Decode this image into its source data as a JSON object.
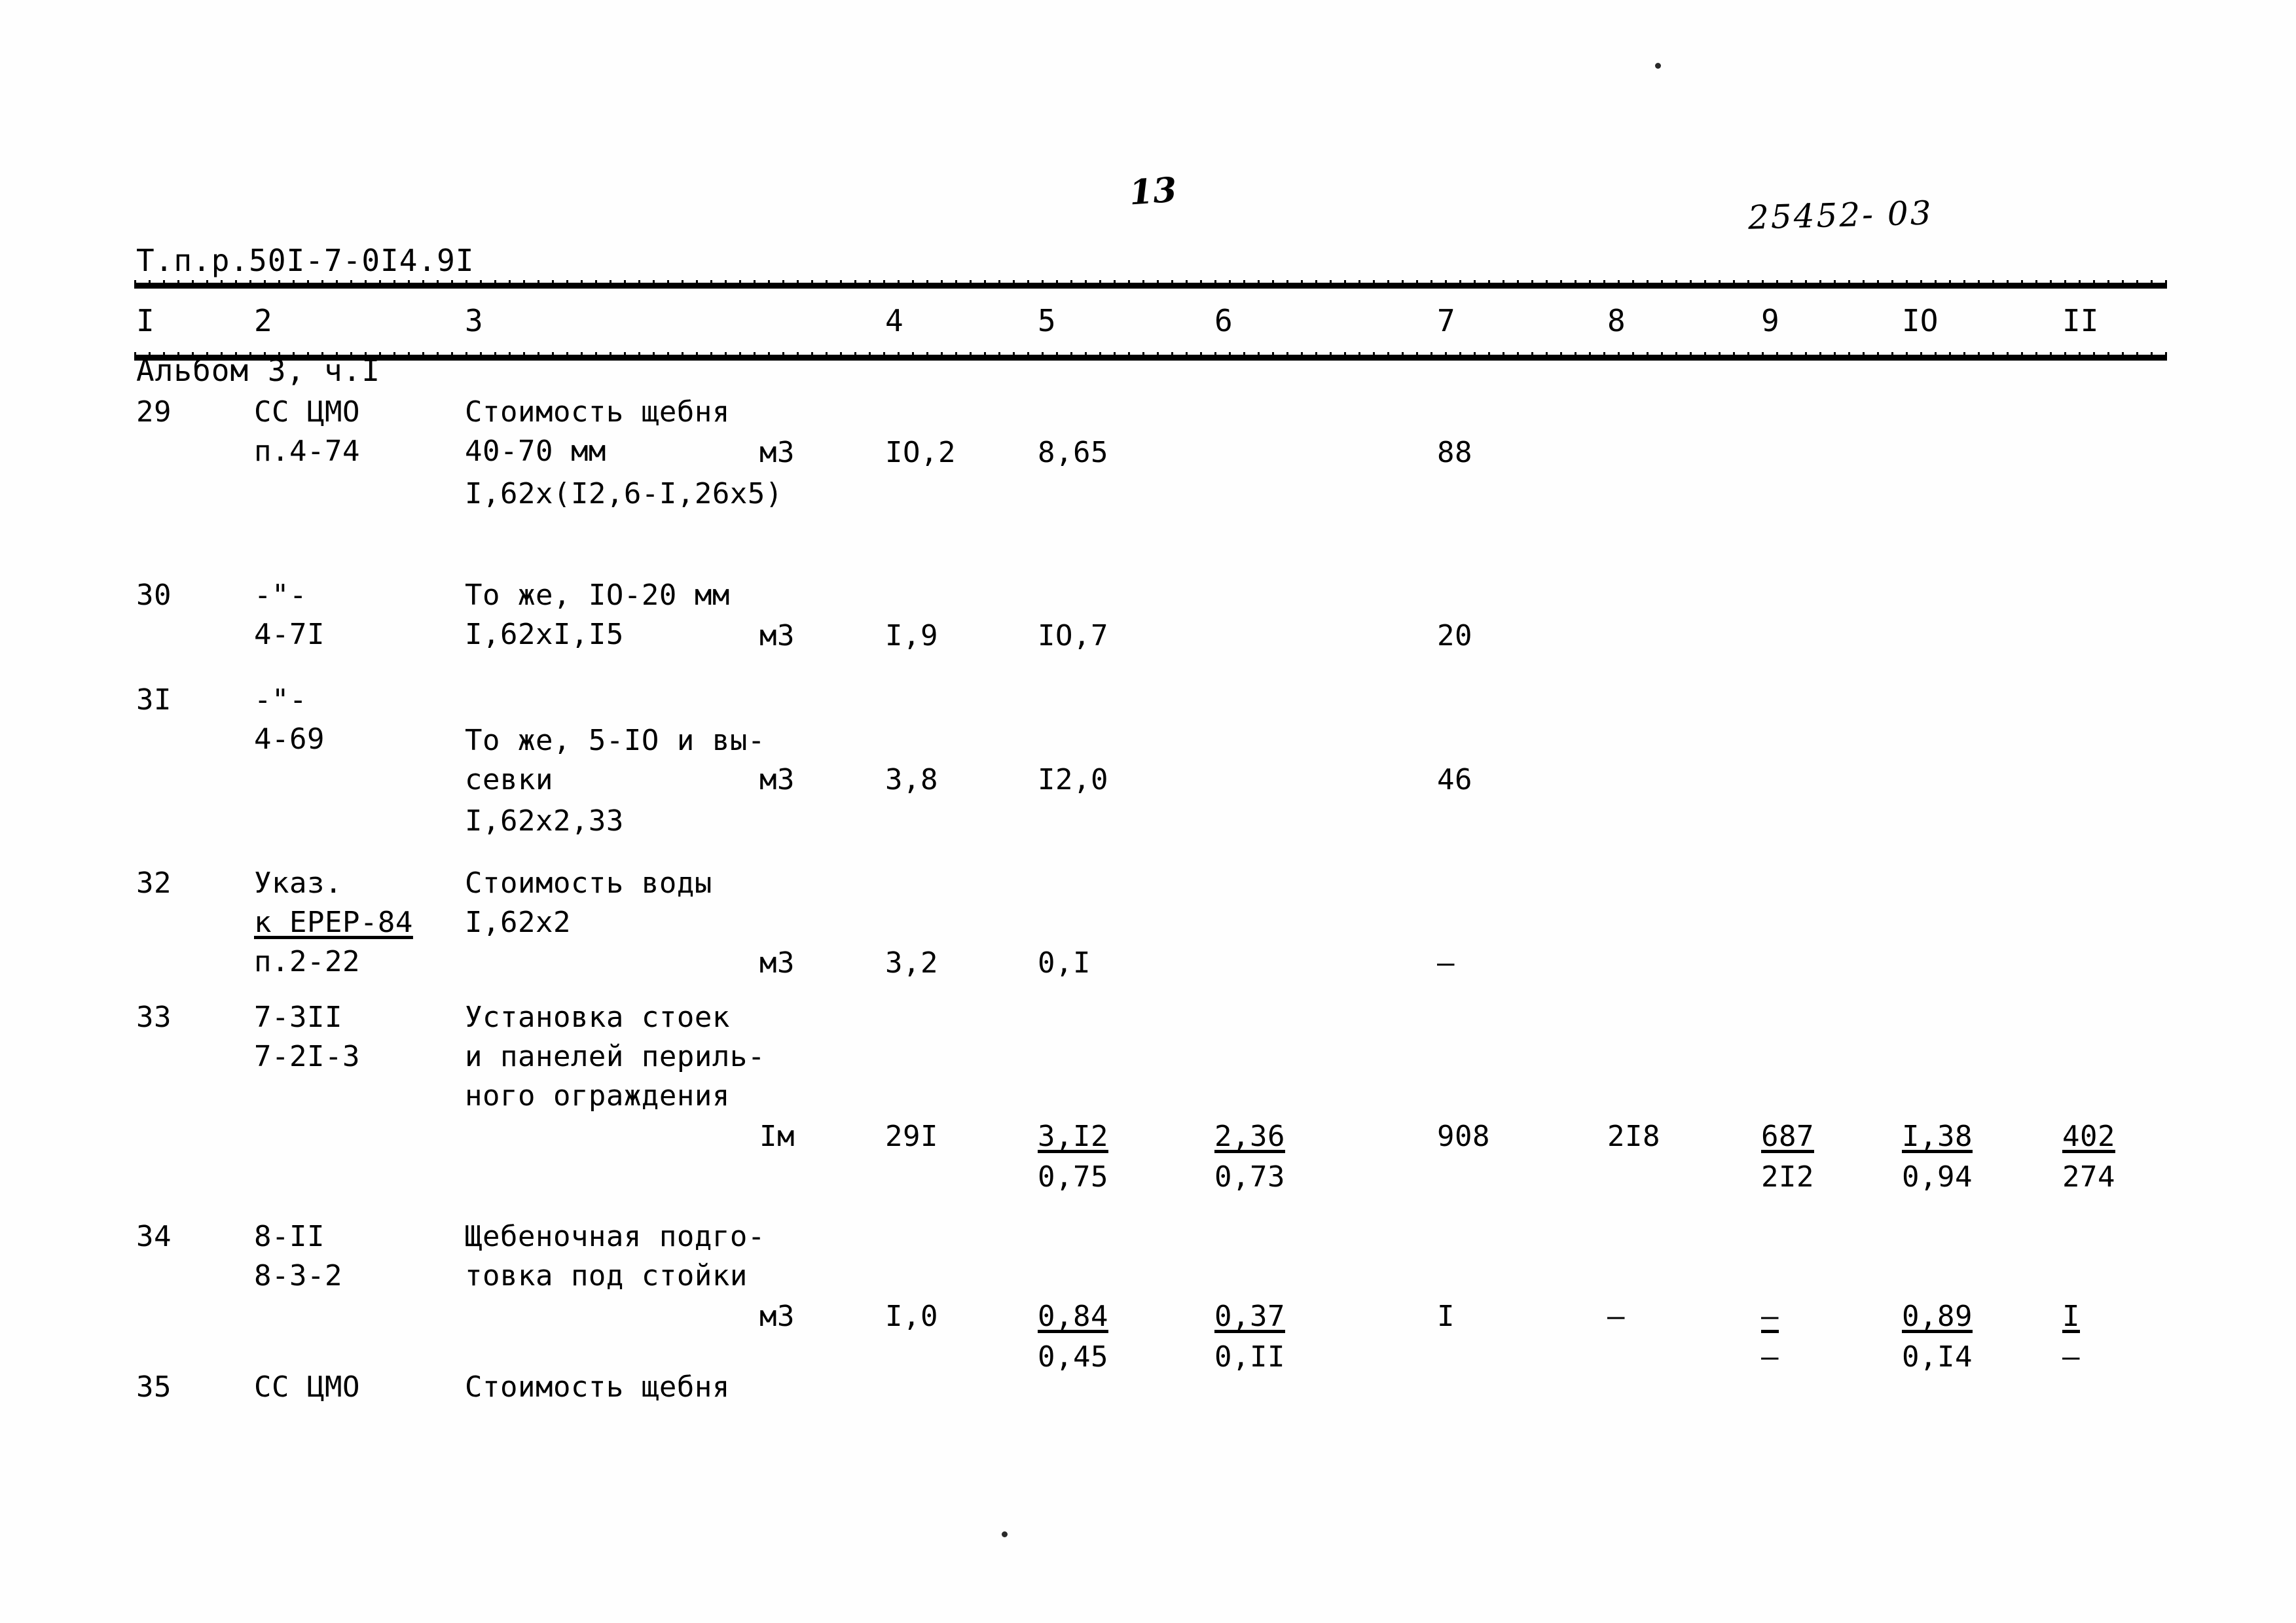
{
  "document": {
    "series_code": "Т.п.р.50I-7-0I4.9I",
    "album": "Альбом 3, ч.I",
    "page_number": "13",
    "archive_stamp": "25452- 03"
  },
  "table": {
    "column_headers": [
      "I",
      "2",
      "3",
      "4",
      "5",
      "6",
      "7",
      "8",
      "9",
      "IO",
      "II"
    ],
    "rows": [
      {
        "num": "29",
        "code_lines": [
          "СС ЦМО",
          "п.4-74"
        ],
        "desc_lines": [
          "Стоимость щебня",
          "40-70 мм"
        ],
        "formula": "I,62х(I2,6-I,26х5)",
        "unit": "м3",
        "c4": "IO,2",
        "c5": "8,65",
        "c6": "",
        "c7": "88",
        "c8": "",
        "c9": "",
        "c10": "",
        "c11": "",
        "c5b": "",
        "c6b": "",
        "c9b": "",
        "c10b": "",
        "c11b": ""
      },
      {
        "num": "30",
        "code_lines": [
          "-\"-",
          "4-7I"
        ],
        "desc_lines": [
          "То же, IO-20 мм",
          "I,62хI,I5"
        ],
        "formula": "",
        "unit": "м3",
        "c4": "I,9",
        "c5": "IO,7",
        "c6": "",
        "c7": "20",
        "c8": "",
        "c9": "",
        "c10": "",
        "c11": "",
        "c5b": "",
        "c6b": "",
        "c9b": "",
        "c10b": "",
        "c11b": ""
      },
      {
        "num": "3I",
        "code_lines": [
          "-\"-",
          "4-69"
        ],
        "desc_lines": [
          "То же, 5-IO и вы-",
          "севки"
        ],
        "formula": "I,62х2,33",
        "unit": "м3",
        "c4": "3,8",
        "c5": "I2,0",
        "c6": "",
        "c7": "46",
        "c8": "",
        "c9": "",
        "c10": "",
        "c11": "",
        "c5b": "",
        "c6b": "",
        "c9b": "",
        "c10b": "",
        "c11b": ""
      },
      {
        "num": "32",
        "code_lines": [
          "Указ.",
          "к ЕРЕР-84",
          "п.2-22"
        ],
        "desc_lines": [
          "Стоимость воды",
          "I,62х2"
        ],
        "formula": "",
        "unit": "м3",
        "c4": "3,2",
        "c5": "0,I",
        "c6": "",
        "c7": "–",
        "c8": "",
        "c9": "",
        "c10": "",
        "c11": "",
        "c5b": "",
        "c6b": "",
        "c9b": "",
        "c10b": "",
        "c11b": ""
      },
      {
        "num": "33",
        "code_lines": [
          "7-3II",
          "7-2I-3"
        ],
        "desc_lines": [
          "Установка стоек",
          "и панелей периль-",
          "ного ограждения"
        ],
        "formula": "",
        "unit": "Iм",
        "c4": "29I",
        "c5": "3,I2",
        "c6": "2,36",
        "c7": "908",
        "c8": "2I8",
        "c9": "687",
        "c10": "I,38",
        "c11": "402",
        "c5b": "0,75",
        "c6b": "0,73",
        "c9b": "2I2",
        "c10b": "0,94",
        "c11b": "274"
      },
      {
        "num": "34",
        "code_lines": [
          "8-II",
          "8-3-2"
        ],
        "desc_lines": [
          "Щебеночная подго-",
          "товка под стойки"
        ],
        "formula": "",
        "unit": "м3",
        "c4": "I,0",
        "c5": "0,84",
        "c6": "0,37",
        "c7": "I",
        "c8": "–",
        "c9": "–",
        "c10": "0,89",
        "c11": "I",
        "c5b": "0,45",
        "c6b": "0,II",
        "c9b": "–",
        "c10b": "0,I4",
        "c11b": "–"
      },
      {
        "num": "35",
        "code_lines": [
          "СС ЦМО"
        ],
        "desc_lines": [
          "Стоимость щебня"
        ],
        "formula": "",
        "unit": "",
        "c4": "",
        "c5": "",
        "c6": "",
        "c7": "",
        "c8": "",
        "c9": "",
        "c10": "",
        "c11": "",
        "c5b": "",
        "c6b": "",
        "c9b": "",
        "c10b": "",
        "c11b": ""
      }
    ]
  }
}
